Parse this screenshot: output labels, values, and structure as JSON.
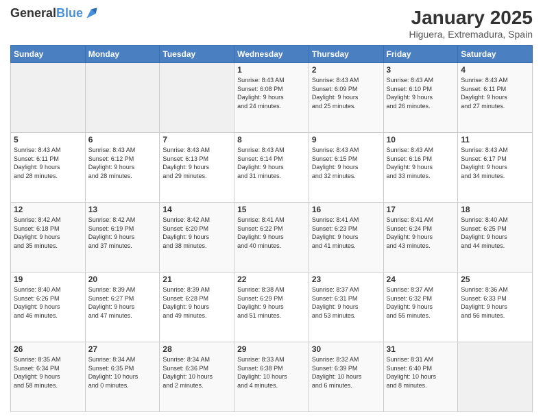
{
  "header": {
    "logo_line1": "General",
    "logo_line2": "Blue",
    "month": "January 2025",
    "location": "Higuera, Extremadura, Spain"
  },
  "weekdays": [
    "Sunday",
    "Monday",
    "Tuesday",
    "Wednesday",
    "Thursday",
    "Friday",
    "Saturday"
  ],
  "weeks": [
    [
      {
        "day": "",
        "info": ""
      },
      {
        "day": "",
        "info": ""
      },
      {
        "day": "",
        "info": ""
      },
      {
        "day": "1",
        "info": "Sunrise: 8:43 AM\nSunset: 6:08 PM\nDaylight: 9 hours\nand 24 minutes."
      },
      {
        "day": "2",
        "info": "Sunrise: 8:43 AM\nSunset: 6:09 PM\nDaylight: 9 hours\nand 25 minutes."
      },
      {
        "day": "3",
        "info": "Sunrise: 8:43 AM\nSunset: 6:10 PM\nDaylight: 9 hours\nand 26 minutes."
      },
      {
        "day": "4",
        "info": "Sunrise: 8:43 AM\nSunset: 6:11 PM\nDaylight: 9 hours\nand 27 minutes."
      }
    ],
    [
      {
        "day": "5",
        "info": "Sunrise: 8:43 AM\nSunset: 6:11 PM\nDaylight: 9 hours\nand 28 minutes."
      },
      {
        "day": "6",
        "info": "Sunrise: 8:43 AM\nSunset: 6:12 PM\nDaylight: 9 hours\nand 28 minutes."
      },
      {
        "day": "7",
        "info": "Sunrise: 8:43 AM\nSunset: 6:13 PM\nDaylight: 9 hours\nand 29 minutes."
      },
      {
        "day": "8",
        "info": "Sunrise: 8:43 AM\nSunset: 6:14 PM\nDaylight: 9 hours\nand 31 minutes."
      },
      {
        "day": "9",
        "info": "Sunrise: 8:43 AM\nSunset: 6:15 PM\nDaylight: 9 hours\nand 32 minutes."
      },
      {
        "day": "10",
        "info": "Sunrise: 8:43 AM\nSunset: 6:16 PM\nDaylight: 9 hours\nand 33 minutes."
      },
      {
        "day": "11",
        "info": "Sunrise: 8:43 AM\nSunset: 6:17 PM\nDaylight: 9 hours\nand 34 minutes."
      }
    ],
    [
      {
        "day": "12",
        "info": "Sunrise: 8:42 AM\nSunset: 6:18 PM\nDaylight: 9 hours\nand 35 minutes."
      },
      {
        "day": "13",
        "info": "Sunrise: 8:42 AM\nSunset: 6:19 PM\nDaylight: 9 hours\nand 37 minutes."
      },
      {
        "day": "14",
        "info": "Sunrise: 8:42 AM\nSunset: 6:20 PM\nDaylight: 9 hours\nand 38 minutes."
      },
      {
        "day": "15",
        "info": "Sunrise: 8:41 AM\nSunset: 6:22 PM\nDaylight: 9 hours\nand 40 minutes."
      },
      {
        "day": "16",
        "info": "Sunrise: 8:41 AM\nSunset: 6:23 PM\nDaylight: 9 hours\nand 41 minutes."
      },
      {
        "day": "17",
        "info": "Sunrise: 8:41 AM\nSunset: 6:24 PM\nDaylight: 9 hours\nand 43 minutes."
      },
      {
        "day": "18",
        "info": "Sunrise: 8:40 AM\nSunset: 6:25 PM\nDaylight: 9 hours\nand 44 minutes."
      }
    ],
    [
      {
        "day": "19",
        "info": "Sunrise: 8:40 AM\nSunset: 6:26 PM\nDaylight: 9 hours\nand 46 minutes."
      },
      {
        "day": "20",
        "info": "Sunrise: 8:39 AM\nSunset: 6:27 PM\nDaylight: 9 hours\nand 47 minutes."
      },
      {
        "day": "21",
        "info": "Sunrise: 8:39 AM\nSunset: 6:28 PM\nDaylight: 9 hours\nand 49 minutes."
      },
      {
        "day": "22",
        "info": "Sunrise: 8:38 AM\nSunset: 6:29 PM\nDaylight: 9 hours\nand 51 minutes."
      },
      {
        "day": "23",
        "info": "Sunrise: 8:37 AM\nSunset: 6:31 PM\nDaylight: 9 hours\nand 53 minutes."
      },
      {
        "day": "24",
        "info": "Sunrise: 8:37 AM\nSunset: 6:32 PM\nDaylight: 9 hours\nand 55 minutes."
      },
      {
        "day": "25",
        "info": "Sunrise: 8:36 AM\nSunset: 6:33 PM\nDaylight: 9 hours\nand 56 minutes."
      }
    ],
    [
      {
        "day": "26",
        "info": "Sunrise: 8:35 AM\nSunset: 6:34 PM\nDaylight: 9 hours\nand 58 minutes."
      },
      {
        "day": "27",
        "info": "Sunrise: 8:34 AM\nSunset: 6:35 PM\nDaylight: 10 hours\nand 0 minutes."
      },
      {
        "day": "28",
        "info": "Sunrise: 8:34 AM\nSunset: 6:36 PM\nDaylight: 10 hours\nand 2 minutes."
      },
      {
        "day": "29",
        "info": "Sunrise: 8:33 AM\nSunset: 6:38 PM\nDaylight: 10 hours\nand 4 minutes."
      },
      {
        "day": "30",
        "info": "Sunrise: 8:32 AM\nSunset: 6:39 PM\nDaylight: 10 hours\nand 6 minutes."
      },
      {
        "day": "31",
        "info": "Sunrise: 8:31 AM\nSunset: 6:40 PM\nDaylight: 10 hours\nand 8 minutes."
      },
      {
        "day": "",
        "info": ""
      }
    ]
  ]
}
